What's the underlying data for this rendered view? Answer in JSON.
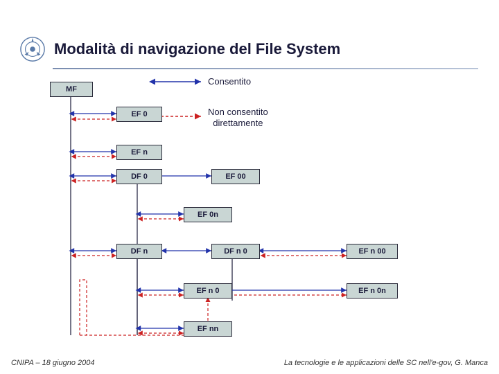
{
  "title": "Modalità di navigazione del File System",
  "legend": {
    "allowed": "Consentito",
    "not_allowed": "Non consentito\ndirettamente"
  },
  "nodes": {
    "mf": "MF",
    "ef0": "EF 0",
    "efn": "EF n",
    "df0": "DF 0",
    "ef00": "EF 00",
    "ef0n": "EF 0n",
    "dfn": "DF n",
    "dfn0": "DF n 0",
    "efn00": "EF n 00",
    "efn0": "EF n 0",
    "efn0n": "EF n 0n",
    "efnn": "EF nn"
  },
  "footer": {
    "left": "CNIPA – 18 giugno 2004",
    "right": "La tecnologie e le applicazioni delle SC nell'e-gov, G. Manca"
  }
}
